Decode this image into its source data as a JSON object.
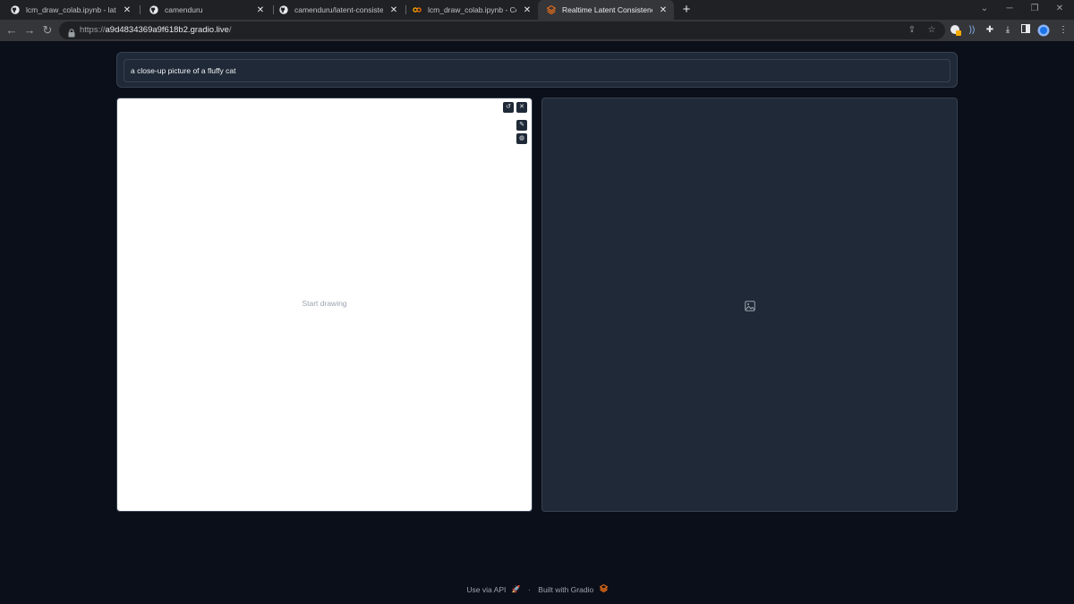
{
  "browser": {
    "tabs": [
      {
        "title": "lcm_draw_colab.ipynb - latent-c",
        "favicon": "github-icon",
        "active": false
      },
      {
        "title": "camenduru",
        "favicon": "github-icon",
        "active": false
      },
      {
        "title": "camenduru/latent-consistency-",
        "favicon": "github-icon",
        "active": false
      },
      {
        "title": "lcm_draw_colab.ipynb - Colabor",
        "favicon": "colab-icon",
        "active": false
      },
      {
        "title": "Realtime Latent Consistency Mo",
        "favicon": "gradio-icon",
        "active": true
      }
    ],
    "close_glyph": "✕",
    "new_tab_glyph": "+",
    "url_scheme": "https://",
    "url_host": "a9d4834369a9f618b2.gradio.live",
    "url_path": "/",
    "colors": {
      "accent": "#8ab4f8",
      "tab_bg": "#202124",
      "toolbar_bg": "#35363a"
    }
  },
  "app": {
    "prompt_value": "a close-up picture of a fluffy cat",
    "canvas_placeholder": "Start drawing",
    "output_icon": "image-icon",
    "footer": {
      "api_label": "Use via API",
      "separator": "·",
      "built_label": "Built with Gradio"
    },
    "colors": {
      "page_bg": "#0b0f19",
      "panel_bg": "#1f2937",
      "border": "#374151",
      "gradio_orange": "#f97316"
    }
  }
}
